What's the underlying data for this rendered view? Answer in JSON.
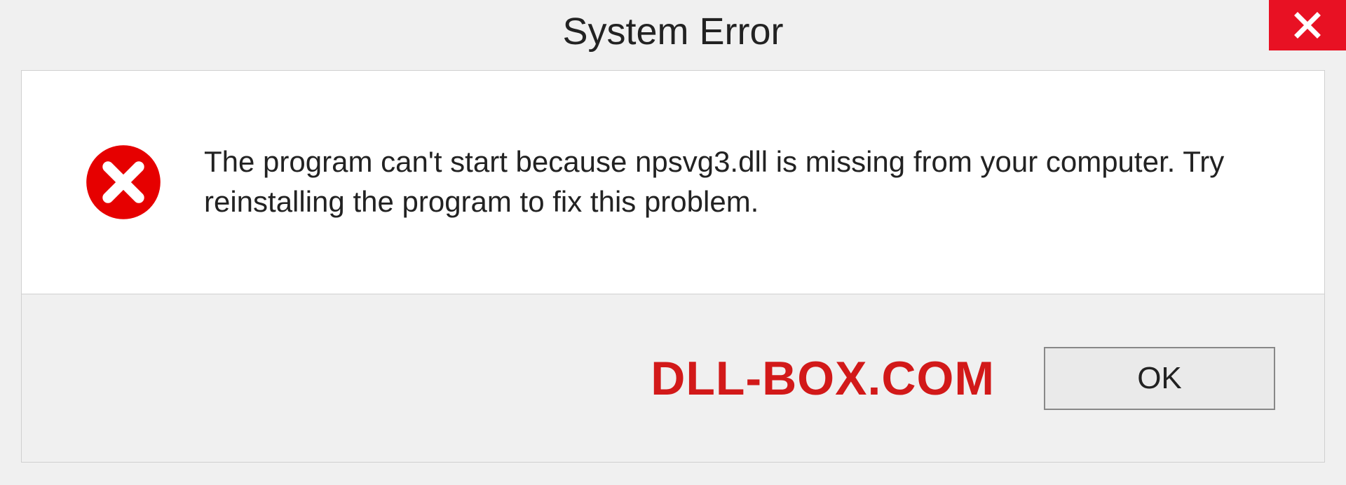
{
  "titlebar": {
    "title": "System Error"
  },
  "dialog": {
    "message": "The program can't start because npsvg3.dll is missing from your computer. Try reinstalling the program to fix this problem."
  },
  "footer": {
    "watermark": "DLL-BOX.COM",
    "ok_label": "OK"
  },
  "colors": {
    "close_bg": "#e81123",
    "error_red": "#d21919"
  }
}
